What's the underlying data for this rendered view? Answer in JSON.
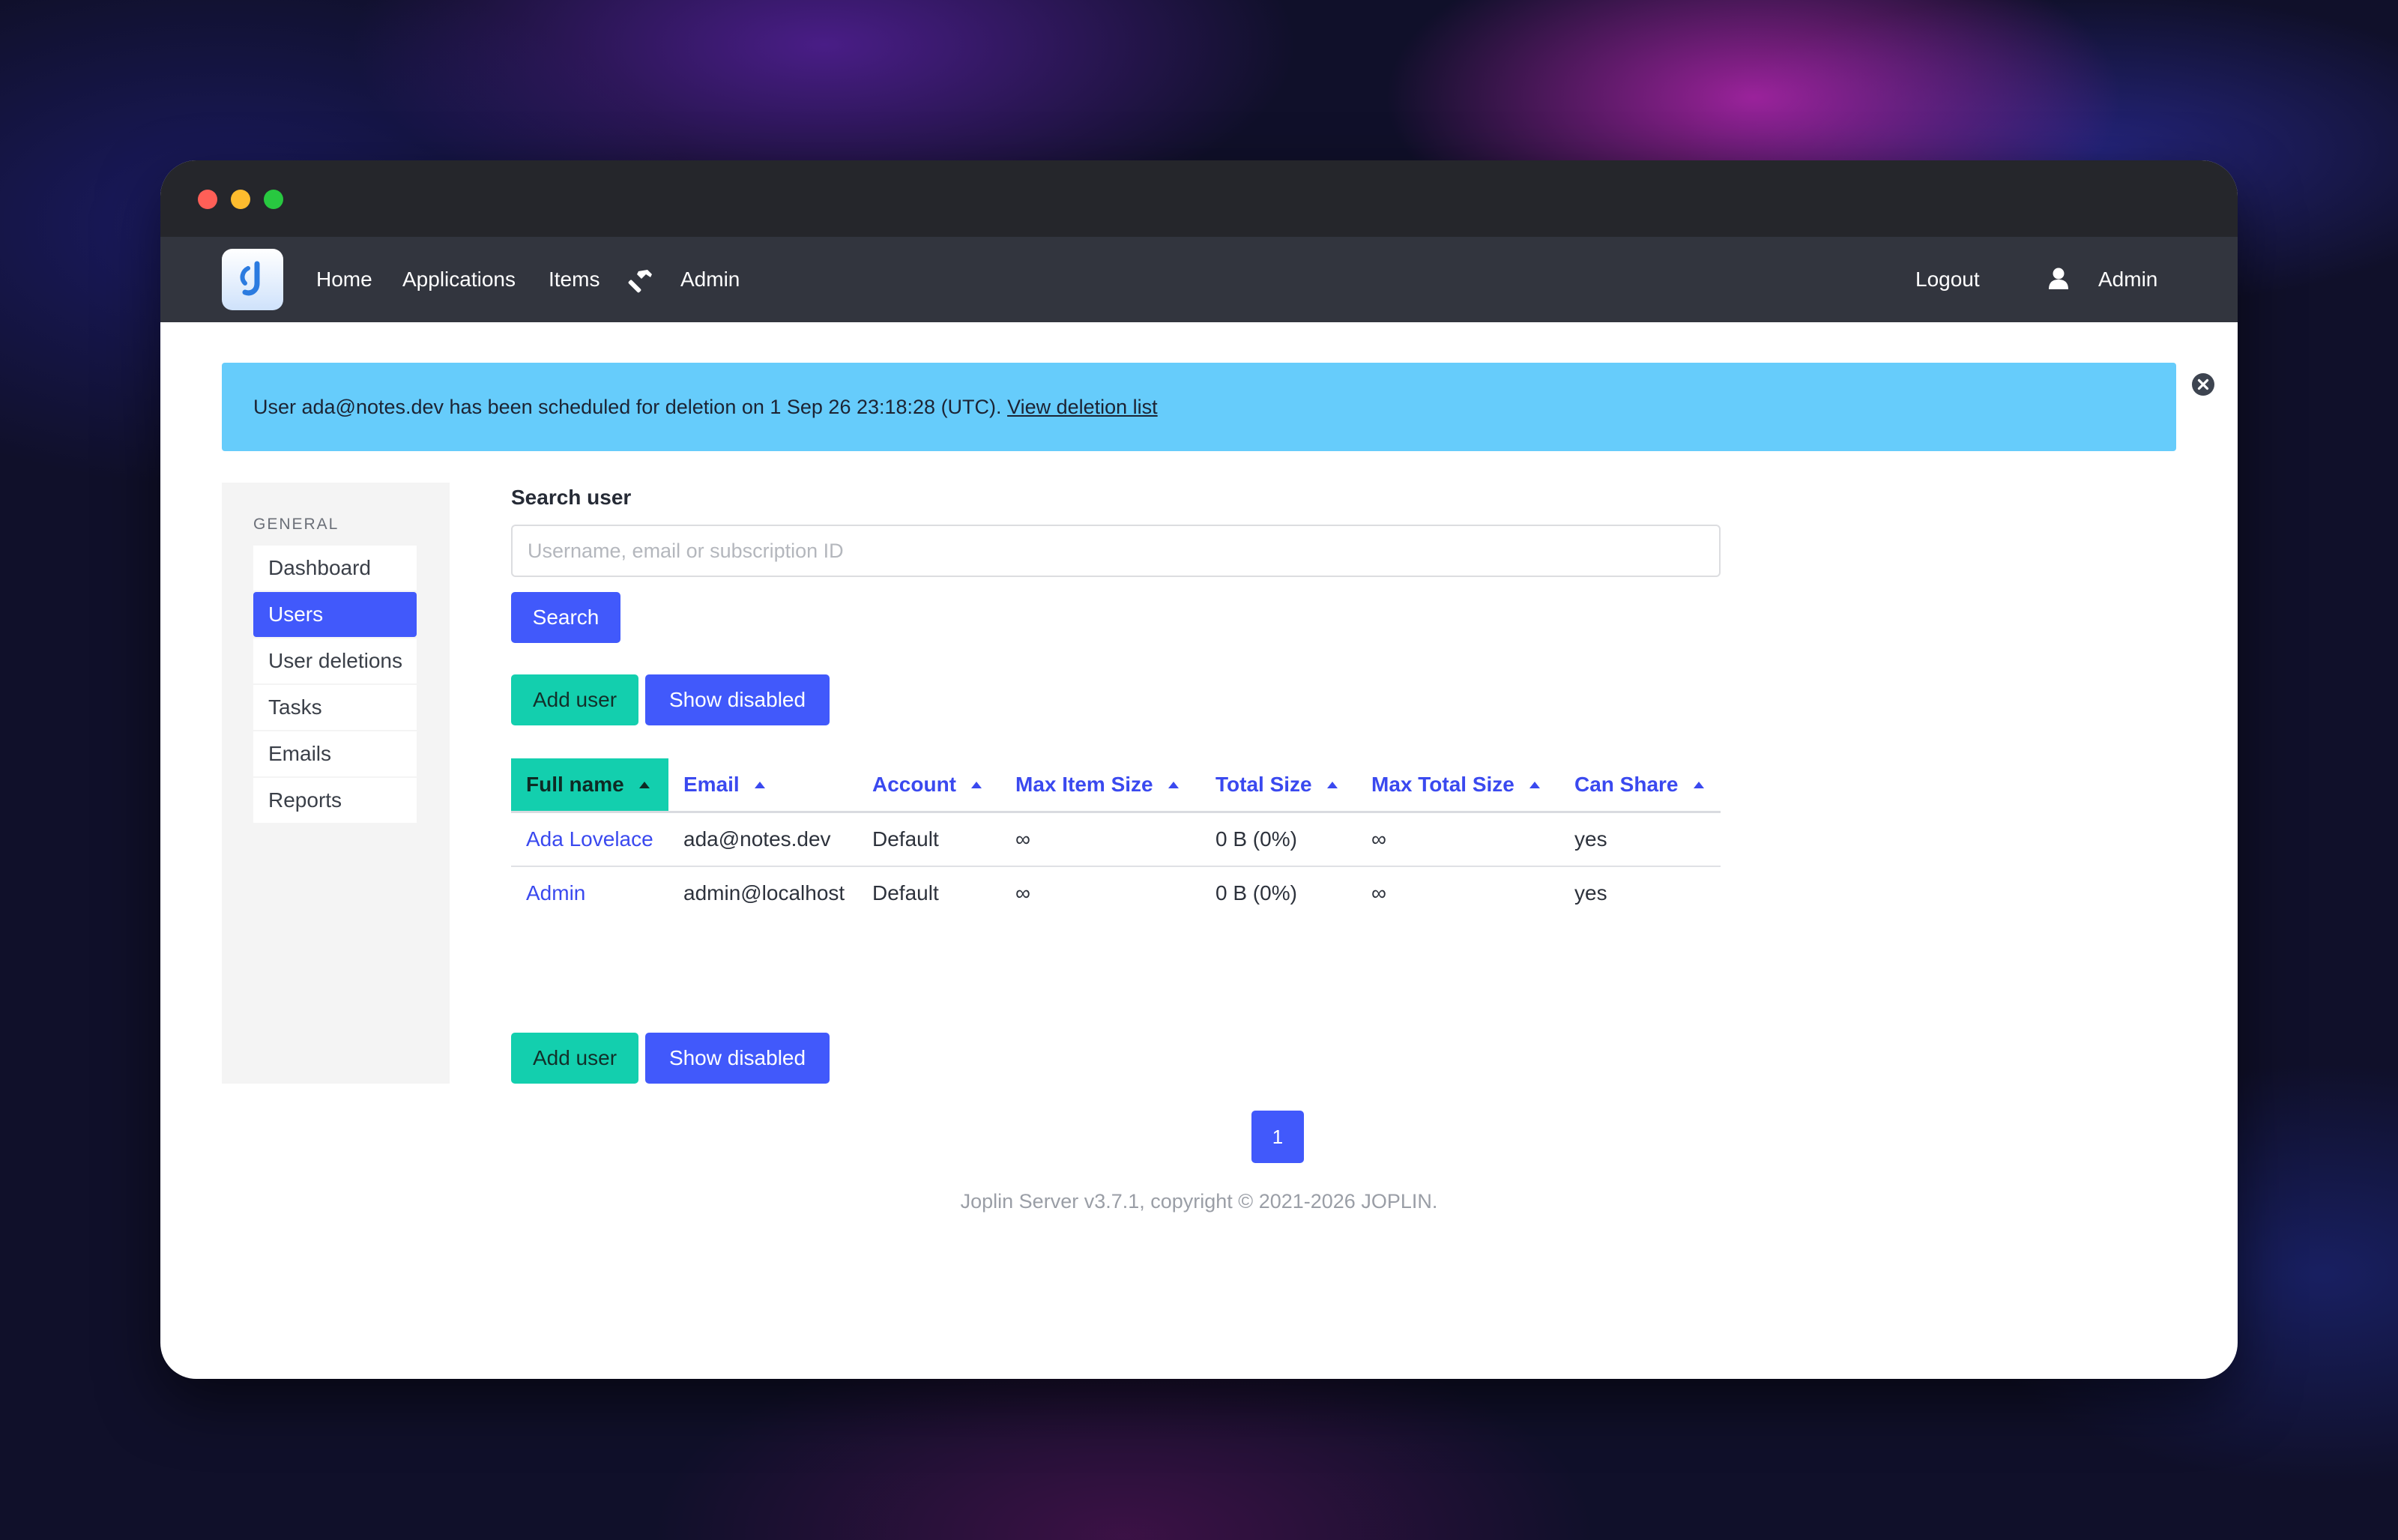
{
  "navbar": {
    "logo_icon": "joplin-logo-icon",
    "items": [
      {
        "label": "Home"
      },
      {
        "label": "Applications"
      },
      {
        "label": "Items"
      },
      {
        "label": "Admin"
      }
    ],
    "logout_label": "Logout",
    "user_label": "Admin"
  },
  "alert": {
    "message": "User ada@notes.dev has been scheduled for deletion on 1 Sep 26 23:18:28 (UTC).",
    "link_label": "View deletion list",
    "background": "#66ccfb"
  },
  "sidebar": {
    "heading": "GENERAL",
    "items": [
      {
        "label": "Dashboard"
      },
      {
        "label": "Users",
        "active": true
      },
      {
        "label": "User deletions"
      },
      {
        "label": "Tasks"
      },
      {
        "label": "Emails"
      },
      {
        "label": "Reports"
      }
    ]
  },
  "search": {
    "label": "Search user",
    "placeholder": "Username, email or subscription ID",
    "value": "",
    "button_label": "Search"
  },
  "actions": {
    "add_user_label": "Add user",
    "show_disabled_label": "Show disabled"
  },
  "table": {
    "sorted_column": "Full name",
    "columns": [
      "Full name",
      "Email",
      "Account",
      "Max Item Size",
      "Total Size",
      "Max Total Size",
      "Can Share"
    ],
    "rows": [
      [
        "Ada Lovelace",
        "ada@notes.dev",
        "Default",
        "∞",
        "0 B (0%)",
        "∞",
        "yes"
      ],
      [
        "Admin",
        "admin@localhost",
        "Default",
        "∞",
        "0 B (0%)",
        "∞",
        "yes"
      ]
    ]
  },
  "pagination": {
    "current_page": "1"
  },
  "footer": {
    "text": "Joplin Server v3.7.1, copyright © 2021-2026 JOPLIN."
  },
  "colors": {
    "primary": "#4159fb",
    "accent": "#13cfae",
    "navbar": "#32353e",
    "titlebar": "#25262b"
  }
}
